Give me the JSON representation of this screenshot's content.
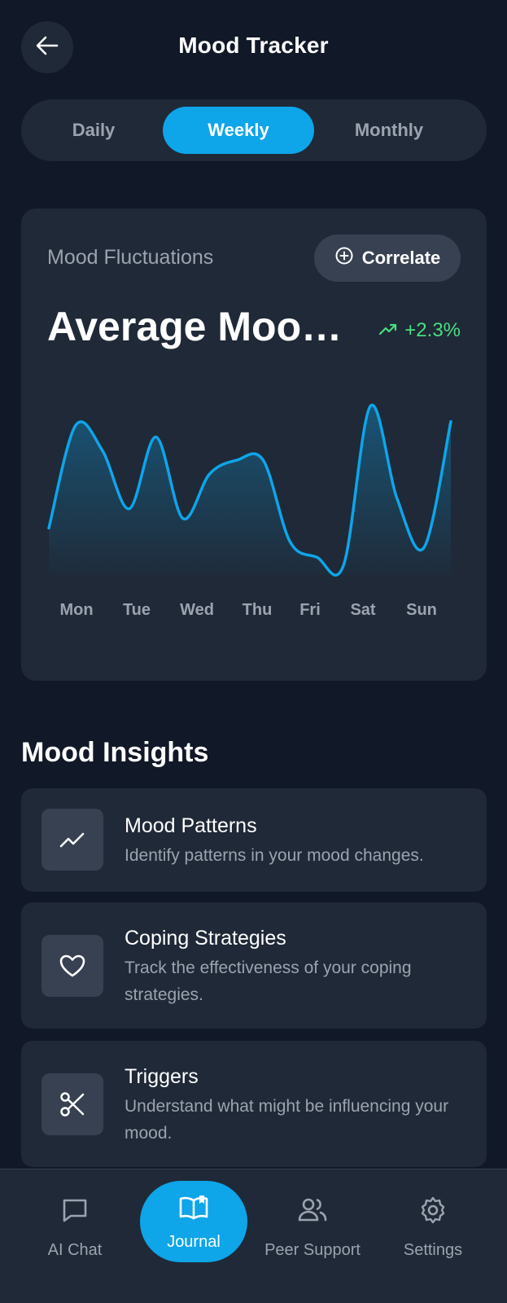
{
  "header": {
    "title": "Mood Tracker",
    "back_icon": "arrow-left-icon"
  },
  "tabs": [
    {
      "label": "Daily",
      "active": false
    },
    {
      "label": "Weekly",
      "active": true
    },
    {
      "label": "Monthly",
      "active": false
    }
  ],
  "mood_card": {
    "subtitle": "Mood Fluctuations",
    "correlate_label": "Correlate",
    "title": "Average Mood...",
    "trend": "+2.3%",
    "accent_color": "#0ea5e9",
    "trend_color": "#4ade80"
  },
  "chart_data": {
    "type": "area",
    "categories": [
      "Mon",
      "Tue",
      "Wed",
      "Thu",
      "Fri",
      "Sat",
      "Sun"
    ],
    "x": [
      0,
      0.25,
      0.5,
      0.75,
      1,
      1.25,
      1.5,
      1.75,
      2,
      2.25,
      2.5,
      2.75,
      3,
      3.25,
      3.5,
      3.75,
      4,
      4.25,
      4.5,
      4.75,
      5,
      5.25,
      5.5,
      5.75,
      6,
      6.25,
      6.5
    ],
    "values": [
      0.25,
      0.78,
      0.65,
      0.35,
      0.72,
      0.3,
      0.53,
      0.6,
      0.6,
      0.18,
      0.1,
      0.06,
      0.88,
      0.4,
      0.15,
      0.8
    ],
    "xlabel": "",
    "ylabel": ""
  },
  "insights": {
    "title": "Mood Insights",
    "items": [
      {
        "title": "Mood Patterns",
        "desc": "Identify patterns in your mood changes.",
        "icon": "trending-up-icon"
      },
      {
        "title": "Coping Strategies",
        "desc": "Track the effectiveness of your coping strategies.",
        "icon": "heart-icon"
      },
      {
        "title": "Triggers",
        "desc": "Understand what might be influencing your mood.",
        "icon": "scissors-icon"
      }
    ]
  },
  "nav": {
    "items": [
      {
        "label": "AI Chat",
        "icon": "chat-icon"
      },
      {
        "label": "Journal",
        "icon": "book-icon",
        "active": true
      },
      {
        "label": "Peer Support",
        "icon": "users-icon"
      },
      {
        "label": "Settings",
        "icon": "gear-icon"
      }
    ]
  }
}
